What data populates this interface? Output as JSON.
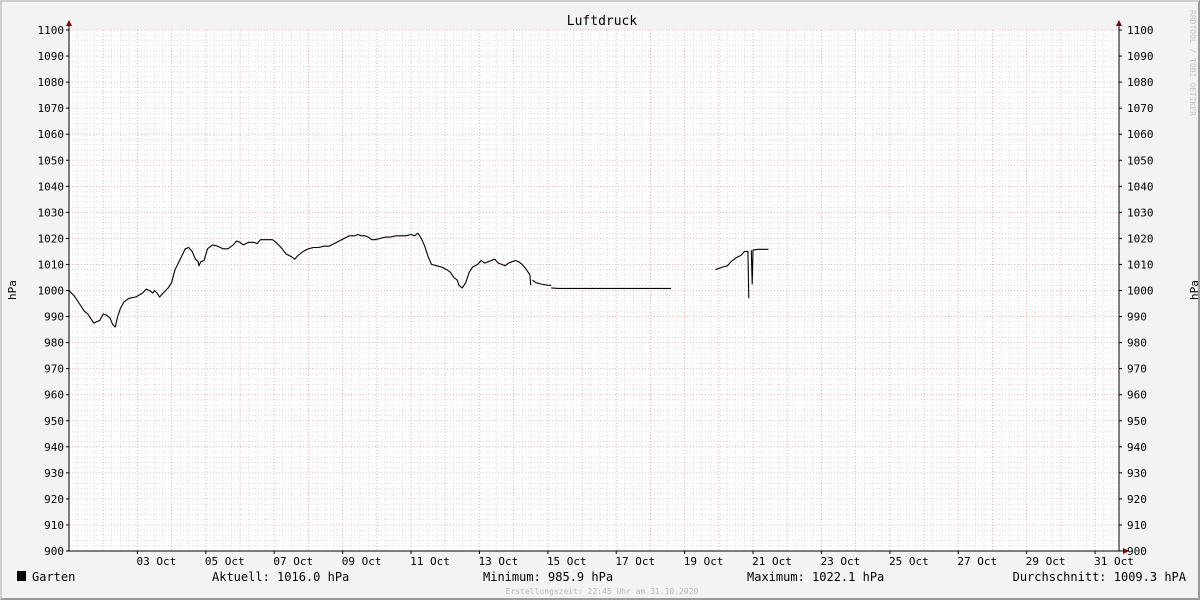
{
  "chart_data": {
    "type": "line",
    "title": "Luftdruck",
    "ylabel_left": "hPa",
    "ylabel_right": "hPa",
    "ylim": [
      900,
      1100
    ],
    "y_ticks": [
      "900",
      "910",
      "920",
      "930",
      "940",
      "950",
      "960",
      "970",
      "980",
      "990",
      "1000",
      "1010",
      "1020",
      "1030",
      "1040",
      "1050",
      "1060",
      "1070",
      "1080",
      "1090",
      "1100"
    ],
    "x_range_days": [
      1,
      31.7
    ],
    "x_ticks": [
      {
        "day": 3,
        "label": "03 Oct"
      },
      {
        "day": 5,
        "label": "05 Oct"
      },
      {
        "day": 7,
        "label": "07 Oct"
      },
      {
        "day": 9,
        "label": "09 Oct"
      },
      {
        "day": 11,
        "label": "11 Oct"
      },
      {
        "day": 13,
        "label": "13 Oct"
      },
      {
        "day": 15,
        "label": "15 Oct"
      },
      {
        "day": 17,
        "label": "17 Oct"
      },
      {
        "day": 19,
        "label": "19 Oct"
      },
      {
        "day": 21,
        "label": "21 Oct"
      },
      {
        "day": 23,
        "label": "23 Oct"
      },
      {
        "day": 25,
        "label": "25 Oct"
      },
      {
        "day": 27,
        "label": "27 Oct"
      },
      {
        "day": 29,
        "label": "29 Oct"
      },
      {
        "day": 31,
        "label": "31 Oct"
      }
    ],
    "grid": true,
    "series": [
      {
        "name": "Garten",
        "color": "#000000",
        "segments": [
          [
            [
              1.0,
              1000
            ],
            [
              1.3,
              998
            ],
            [
              1.6,
              995
            ],
            [
              1.9,
              992
            ],
            [
              2.1,
              991
            ],
            [
              2.3,
              989
            ],
            [
              2.45,
              987.5
            ],
            [
              2.6,
              988
            ],
            [
              2.8,
              988.5
            ],
            [
              3.0,
              991
            ],
            [
              3.2,
              990.5
            ],
            [
              3.4,
              989.5
            ],
            [
              3.55,
              987
            ],
            [
              3.7,
              986
            ],
            [
              3.85,
              990
            ],
            [
              4.0,
              993
            ],
            [
              4.2,
              995.5
            ],
            [
              4.5,
              997
            ],
            [
              4.9,
              997.5
            ],
            [
              5.3,
              999
            ],
            [
              5.5,
              1000.5
            ],
            [
              5.7,
              1000
            ],
            [
              5.9,
              999
            ],
            [
              6.0,
              1000
            ],
            [
              6.15,
              999
            ],
            [
              6.3,
              997.5
            ],
            [
              6.5,
              999
            ],
            [
              6.8,
              1001
            ],
            [
              7.0,
              1003
            ],
            [
              7.2,
              1008
            ],
            [
              7.5,
              1012
            ],
            [
              7.8,
              1016
            ],
            [
              8.0,
              1016.5
            ],
            [
              8.2,
              1015
            ],
            [
              8.4,
              1012
            ],
            [
              8.55,
              1011
            ],
            [
              8.6,
              1009.5
            ],
            [
              8.7,
              1011
            ],
            [
              8.9,
              1011.5
            ],
            [
              9.1,
              1016
            ],
            [
              9.4,
              1017.5
            ],
            [
              9.7,
              1017
            ],
            [
              10.0,
              1016
            ],
            [
              10.3,
              1016
            ],
            [
              10.6,
              1017.5
            ],
            [
              10.8,
              1019
            ],
            [
              11.0,
              1018.5
            ],
            [
              11.2,
              1017.5
            ],
            [
              11.5,
              1018.5
            ],
            [
              11.8,
              1018.5
            ],
            [
              12.0,
              1018
            ],
            [
              12.2,
              1019.5
            ],
            [
              12.6,
              1019.5
            ],
            [
              12.9,
              1019.5
            ],
            [
              13.1,
              1018.5
            ],
            [
              13.4,
              1016.5
            ],
            [
              13.7,
              1014
            ],
            [
              14.0,
              1013
            ],
            [
              14.2,
              1012
            ],
            [
              14.4,
              1013.5
            ],
            [
              14.7,
              1015
            ],
            [
              15.0,
              1016
            ],
            [
              15.3,
              1016.5
            ],
            [
              15.6,
              1016.5
            ],
            [
              15.9,
              1017
            ],
            [
              16.2,
              1017
            ],
            [
              16.5,
              1018
            ],
            [
              16.8,
              1019
            ],
            [
              17.1,
              1020
            ],
            [
              17.4,
              1021
            ],
            [
              17.7,
              1021
            ],
            [
              17.9,
              1021.5
            ],
            [
              18.1,
              1021
            ],
            [
              18.3,
              1021
            ],
            [
              18.5,
              1020.5
            ],
            [
              18.7,
              1019.5
            ],
            [
              18.9,
              1019.5
            ],
            [
              19.2,
              1020
            ],
            [
              19.5,
              1020.5
            ],
            [
              19.8,
              1020.5
            ],
            [
              20.1,
              1021
            ],
            [
              20.4,
              1021
            ],
            [
              20.7,
              1021
            ],
            [
              21.0,
              1021.5
            ],
            [
              21.2,
              1021
            ],
            [
              21.4,
              1022
            ],
            [
              21.6,
              1020
            ],
            [
              21.8,
              1017
            ],
            [
              22.0,
              1013
            ],
            [
              22.2,
              1010
            ],
            [
              22.5,
              1009.5
            ],
            [
              22.8,
              1009
            ],
            [
              23.1,
              1008
            ],
            [
              23.3,
              1007
            ],
            [
              23.5,
              1005
            ],
            [
              23.7,
              1004
            ],
            [
              23.8,
              1002
            ],
            [
              24.0,
              1001
            ],
            [
              24.2,
              1003
            ],
            [
              24.4,
              1007
            ],
            [
              24.6,
              1009
            ],
            [
              24.9,
              1010
            ],
            [
              25.1,
              1011.5
            ],
            [
              25.3,
              1010.5
            ],
            [
              25.5,
              1011
            ],
            [
              25.7,
              1011.5
            ],
            [
              25.9,
              1012
            ],
            [
              26.1,
              1010.5
            ],
            [
              26.3,
              1010
            ],
            [
              26.5,
              1009.5
            ],
            [
              26.7,
              1010.5
            ],
            [
              26.9,
              1011
            ],
            [
              27.1,
              1011.5
            ],
            [
              27.3,
              1011
            ],
            [
              27.5,
              1010
            ],
            [
              27.7,
              1008.5
            ],
            [
              27.85,
              1007
            ],
            [
              27.95,
              1006
            ],
            [
              28.0,
              1002
            ]
          ],
          [
            [
              28.1,
              1004
            ],
            [
              28.3,
              1003
            ],
            [
              28.6,
              1002.5
            ],
            [
              29.0,
              1002
            ],
            [
              29.2,
              1002
            ]
          ],
          [
            [
              29.2,
              1001
            ],
            [
              29.6,
              1000.8
            ],
            [
              30.5,
              1000.8
            ],
            [
              31.4,
              1000.8
            ],
            [
              32.2,
              1000.8
            ],
            [
              32.9,
              1000.8
            ],
            [
              33.5,
              1000.8
            ],
            [
              34.2,
              1000.8
            ],
            [
              35.6,
              1000.8
            ],
            [
              36.2,
              1000.8
            ]
          ],
          [
            [
              38.8,
              1008
            ],
            [
              39.2,
              1009
            ],
            [
              39.5,
              1009.5
            ],
            [
              39.7,
              1011
            ],
            [
              40.0,
              1012.5
            ],
            [
              40.3,
              1013.5
            ],
            [
              40.5,
              1015
            ],
            [
              40.7,
              1015
            ],
            [
              40.75,
              997
            ]
          ],
          [
            [
              40.9,
              1015.5
            ],
            [
              40.95,
              1002.5
            ],
            [
              41.0,
              1015.5
            ],
            [
              41.3,
              1015.8
            ],
            [
              41.7,
              1015.8
            ],
            [
              41.9,
              1015.8
            ]
          ]
        ]
      }
    ]
  },
  "legend": {
    "label": "Garten",
    "color": "#000000"
  },
  "stats": {
    "current": "Aktuell: 1016.0 hPa",
    "minimum": "Minimum: 985.9 hPa",
    "maximum": "Maximum: 1022.1 hPa",
    "average": "Durchschnitt: 1009.3 hPA"
  },
  "footer": "Erstellungszeit: 22:45 Uhr am 31.10.2020",
  "watermark": "RRDTOOL / TOBI OETIKER",
  "colors": {
    "background": "#f3f3f3",
    "plot": "#ffffff",
    "grid_minor": "#c9c9c9",
    "grid_major": "#e6a6a6",
    "axis": "#000000",
    "arrow": "#8b0000"
  }
}
